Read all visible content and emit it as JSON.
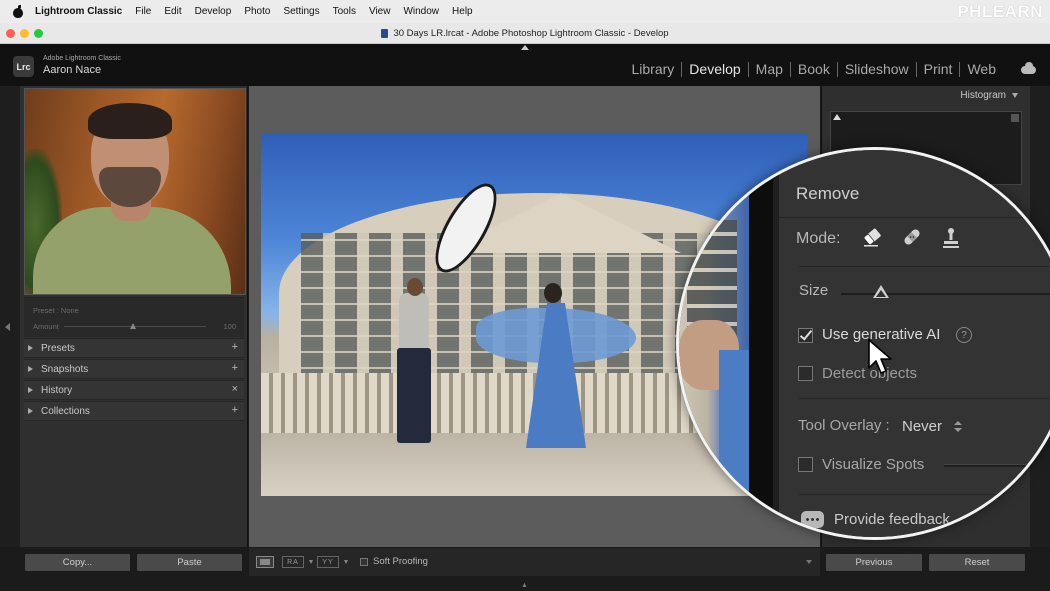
{
  "menubar": {
    "app_name": "Lightroom Classic",
    "items": [
      "File",
      "Edit",
      "Develop",
      "Photo",
      "Settings",
      "Tools",
      "View",
      "Window",
      "Help"
    ],
    "watermark": "PHLEARN"
  },
  "window": {
    "title": "30 Days LR.lrcat - Adobe Photoshop Lightroom Classic - Develop"
  },
  "identity": {
    "badge": "Lrc",
    "product": "Adobe Lightroom Classic",
    "user": "Aaron Nace"
  },
  "modules": {
    "items": [
      "Library",
      "Develop",
      "Map",
      "Book",
      "Slideshow",
      "Print",
      "Web"
    ],
    "active": "Develop"
  },
  "left_panel": {
    "preset_label": "Preset : None",
    "amount_label": "Amount",
    "amount_value": "100",
    "amount_fraction": 0.5,
    "sections": [
      {
        "label": "Presets",
        "action": "+"
      },
      {
        "label": "Snapshots",
        "action": "+"
      },
      {
        "label": "History",
        "action": "×"
      },
      {
        "label": "Collections",
        "action": "+"
      }
    ],
    "copy_label": "Copy...",
    "paste_label": "Paste"
  },
  "right_panel": {
    "histogram_label": "Histogram",
    "previous_label": "Previous",
    "reset_label": "Reset"
  },
  "toolbar": {
    "ra_label": "RA",
    "yy_label": "YY",
    "soft_proofing_label": "Soft Proofing"
  },
  "remove_panel": {
    "title": "Remove",
    "mode_label": "Mode:",
    "mode_icons": [
      "eraser-icon",
      "healing-bandage-icon",
      "clone-stamp-icon"
    ],
    "size_label": "Size",
    "size_fraction": 0.15,
    "generative_ai_label": "Use generative AI",
    "generative_ai_checked": true,
    "detect_objects_label": "Detect objects",
    "detect_objects_checked": false,
    "tool_overlay_label": "Tool Overlay :",
    "tool_overlay_value": "Never",
    "visualize_spots_label": "Visualize Spots",
    "visualize_spots_checked": false,
    "feedback_label": "Provide feedback"
  },
  "colors": {
    "panel": "#2f2f2f",
    "center_bg": "#5c5c5c",
    "active_module": "#e6e6e6"
  }
}
